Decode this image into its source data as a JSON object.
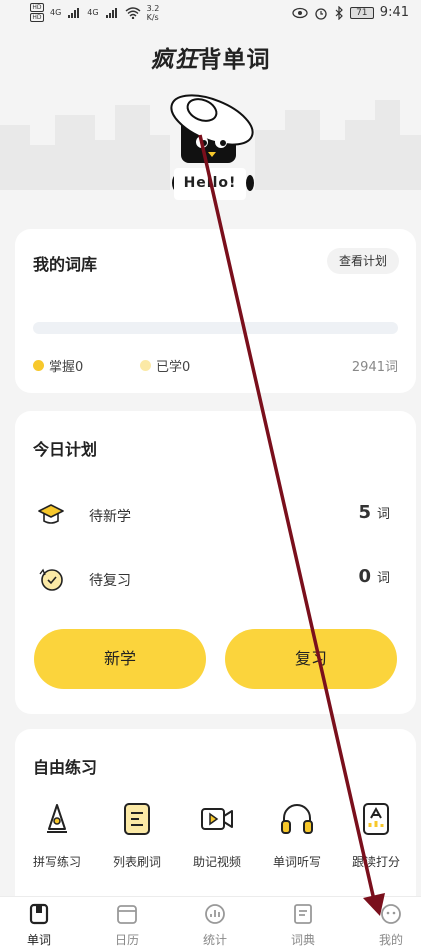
{
  "status_bar": {
    "hd_label": "HD",
    "net1": "4G",
    "net2": "4G",
    "speed_value": "3.2",
    "speed_unit": "K/s",
    "battery": "71",
    "time": "9:41"
  },
  "app": {
    "title_part1": "疯狂",
    "title_part2": "背单词",
    "mascot_greeting": "Hello!"
  },
  "word_library": {
    "title": "我的词库",
    "view_plan_label": "查看计划",
    "progress": 0,
    "mastered_label": "掌握0",
    "learned_label": "已学0",
    "total_label": "2941词",
    "colors": {
      "mastered": "#f7c82c",
      "learned": "#fbe9a6",
      "track": "#eef1f5"
    }
  },
  "today_plan": {
    "title": "今日计划",
    "new_label": "待新学",
    "new_count": "5",
    "review_label": "待复习",
    "review_count": "0",
    "unit": "词",
    "learn_button": "新学",
    "review_button": "复习"
  },
  "free_practice": {
    "title": "自由练习",
    "items": [
      {
        "label": "拼写练习",
        "icon": "pen-nib-icon"
      },
      {
        "label": "列表刷词",
        "icon": "list-icon"
      },
      {
        "label": "助记视频",
        "icon": "video-icon"
      },
      {
        "label": "单词听写",
        "icon": "headphones-icon"
      },
      {
        "label": "跟读打分",
        "icon": "mic-score-icon"
      }
    ]
  },
  "tab_bar": {
    "items": [
      {
        "label": "单词",
        "icon": "book-icon",
        "active": true
      },
      {
        "label": "日历",
        "icon": "calendar-icon",
        "active": false
      },
      {
        "label": "统计",
        "icon": "stats-icon",
        "active": false
      },
      {
        "label": "词典",
        "icon": "dictionary-icon",
        "active": false
      },
      {
        "label": "我的",
        "icon": "profile-icon",
        "active": false
      }
    ]
  },
  "colors": {
    "accent": "#fbd43c",
    "background": "#f4f4f4",
    "annotation_arrow": "#7a0f1c"
  }
}
